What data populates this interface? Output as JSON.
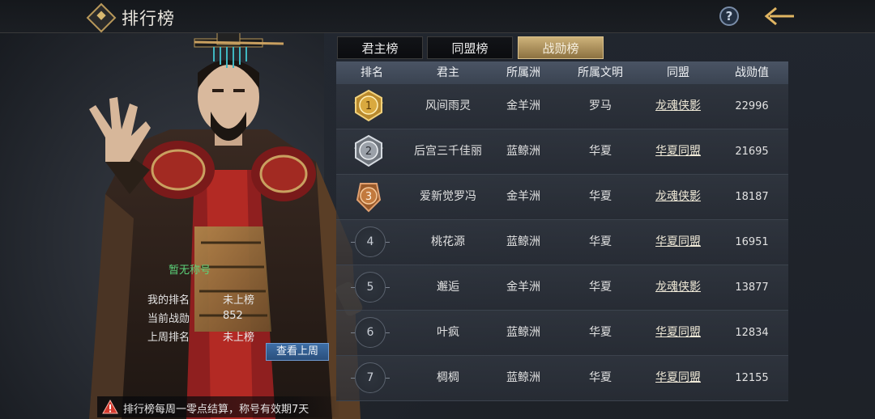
{
  "header": {
    "title": "排行榜",
    "help_icon": "help-icon",
    "help_label": "?",
    "back_icon": "back-arrow-icon"
  },
  "tabs": [
    {
      "label": "君主榜",
      "active": false
    },
    {
      "label": "同盟榜",
      "active": false
    },
    {
      "label": "战勋榜",
      "active": true
    }
  ],
  "table": {
    "headers": [
      "排名",
      "君主",
      "所属洲",
      "所属文明",
      "同盟",
      "战勋值"
    ],
    "rows": [
      {
        "rank": "1",
        "lord": "风间雨灵",
        "continent": "金羊洲",
        "civ": "罗马",
        "alliance": "龙魂侠影",
        "score": "22996"
      },
      {
        "rank": "2",
        "lord": "后宫三千佳丽",
        "continent": "蓝鲸洲",
        "civ": "华夏",
        "alliance": "华夏同盟",
        "score": "21695"
      },
      {
        "rank": "3",
        "lord": "爱新觉罗冯",
        "continent": "金羊洲",
        "civ": "华夏",
        "alliance": "龙魂侠影",
        "score": "18187"
      },
      {
        "rank": "4",
        "lord": "桃花源",
        "continent": "蓝鲸洲",
        "civ": "华夏",
        "alliance": "华夏同盟",
        "score": "16951"
      },
      {
        "rank": "5",
        "lord": "邂逅",
        "continent": "金羊洲",
        "civ": "华夏",
        "alliance": "龙魂侠影",
        "score": "13877"
      },
      {
        "rank": "6",
        "lord": "叶疯",
        "continent": "蓝鲸洲",
        "civ": "华夏",
        "alliance": "华夏同盟",
        "score": "12834"
      },
      {
        "rank": "7",
        "lord": "椆椆",
        "continent": "蓝鲸洲",
        "civ": "华夏",
        "alliance": "华夏同盟",
        "score": "12155"
      }
    ]
  },
  "player": {
    "title": "暂无称号",
    "my_rank_label": "我的排名",
    "my_rank_value": "未上榜",
    "current_label": "当前战勋",
    "current_value": "852",
    "last_week_label": "上周排名",
    "last_week_value": "未上榜",
    "view_last_week_button": "查看上周"
  },
  "notice": {
    "icon": "warning-icon",
    "text": "排行榜每周一零点结算，称号有效期7天"
  },
  "colors": {
    "gold": "#c9ad74",
    "title_green": "#5cd37a",
    "button_blue": "#3d6ea6"
  }
}
